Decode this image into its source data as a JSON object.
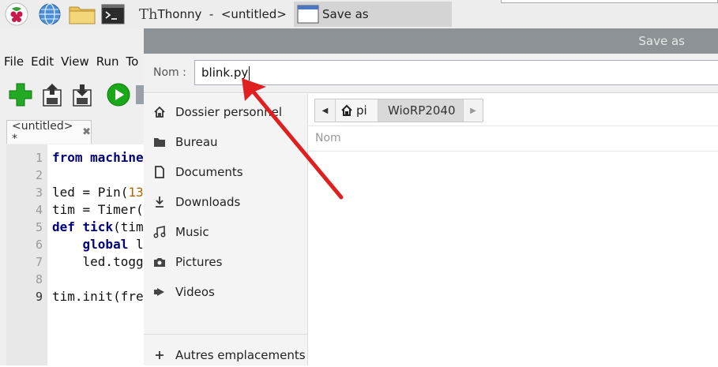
{
  "taskbar": {
    "tasks": [
      {
        "label": "Thonny  -  <untitled>  …"
      },
      {
        "label": "Save as"
      }
    ]
  },
  "thonny": {
    "menu": [
      "File",
      "Edit",
      "View",
      "Run",
      "To"
    ],
    "tab_label": "<untitled> *",
    "line_numbers": [
      "1",
      "2",
      "3",
      "4",
      "5",
      "6",
      "7",
      "8",
      "9"
    ],
    "code": {
      "l1": "from machine",
      "l3a": "led = Pin(",
      "l3b": "13",
      "l4": "tim = Timer(",
      "l5a": "def",
      "l5b": " tick",
      "l5c": "(tim",
      "l6a": "    global",
      "l6b": " l",
      "l7": "    led.togg",
      "l9": "tim.init(fre"
    }
  },
  "dialog": {
    "title": "Save as",
    "name_label": "Nom :",
    "name_value": "blink.py",
    "places": [
      {
        "label": "Dossier personnel",
        "icon": "home-icon"
      },
      {
        "label": "Bureau",
        "icon": "folder-icon"
      },
      {
        "label": "Documents",
        "icon": "document-icon"
      },
      {
        "label": "Downloads",
        "icon": "download-icon"
      },
      {
        "label": "Music",
        "icon": "music-icon"
      },
      {
        "label": "Pictures",
        "icon": "camera-icon"
      },
      {
        "label": "Videos",
        "icon": "video-icon"
      }
    ],
    "other_locations": "Autres emplacements",
    "path": [
      "pi",
      "WioRP2040"
    ],
    "column_name": "Nom"
  },
  "colors": {
    "annotation_arrow": "#e02020",
    "dialog_title_bar": "#8c9296",
    "run_button": "#18a818",
    "new_button": "#22aa22"
  }
}
